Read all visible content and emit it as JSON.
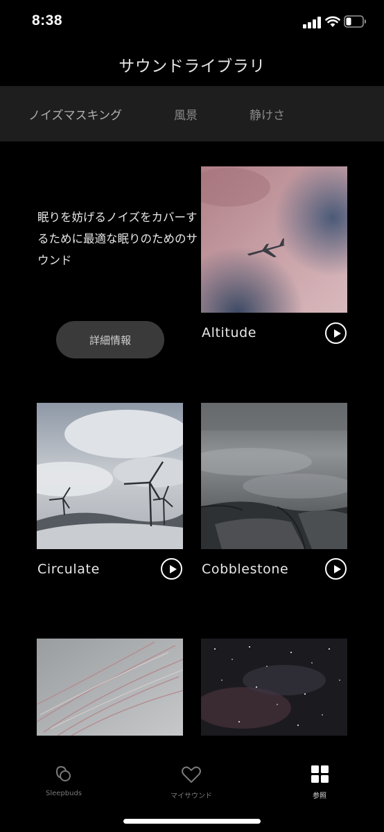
{
  "status_bar": {
    "time": "8:38"
  },
  "header": {
    "title": "サウンドライブラリ"
  },
  "tabs": [
    {
      "label": "ノイズマスキング",
      "active": true
    },
    {
      "label": "風景",
      "active": false
    },
    {
      "label": "静けさ",
      "active": false
    }
  ],
  "intro": {
    "text": "眠りを妨げるノイズをカバーするために最適な眠りのためのサウンド",
    "button_label": "詳細情報"
  },
  "sounds": [
    {
      "title": "Altitude"
    },
    {
      "title": "Circulate"
    },
    {
      "title": "Cobblestone"
    }
  ],
  "bottom_nav": {
    "items": [
      {
        "label": "Sleepbuds",
        "icon": "sleepbuds-icon",
        "active": false
      },
      {
        "label": "マイサウンド",
        "icon": "heart-icon",
        "active": false
      },
      {
        "label": "参照",
        "icon": "grid-icon",
        "active": true
      }
    ]
  },
  "colors": {
    "background": "#000000",
    "tab_bar": "#1e1e1e",
    "button": "#3a3a3a"
  }
}
